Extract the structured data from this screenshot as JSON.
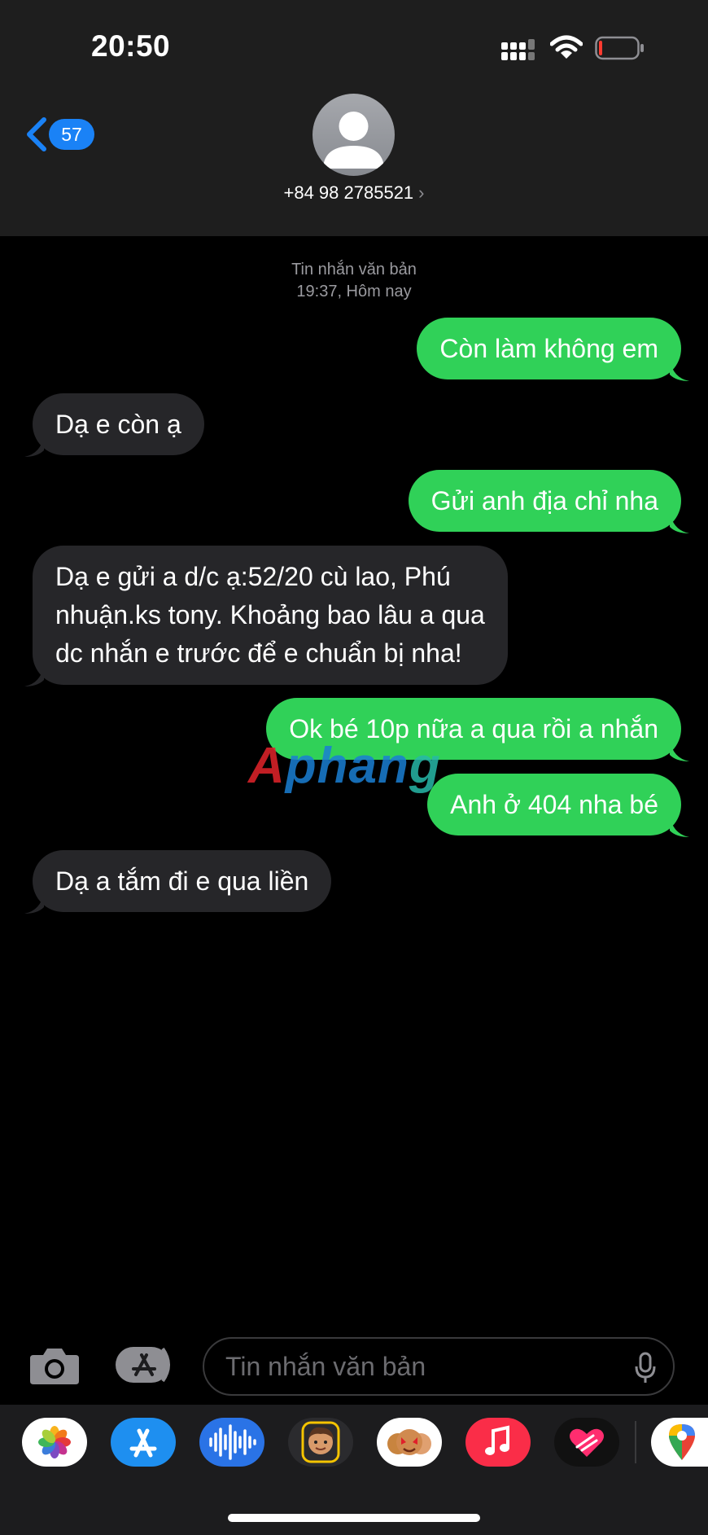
{
  "status_bar": {
    "time": "20:50"
  },
  "nav": {
    "back_count": "57",
    "contact": "+84 98 2785521",
    "contact_chevron": "›"
  },
  "thread": {
    "service": "Tin nhắn văn bản",
    "timestamp": "19:37, Hôm nay"
  },
  "messages": [
    {
      "dir": "sent",
      "text": "Còn làm không em"
    },
    {
      "dir": "received",
      "text": "Dạ e còn ạ"
    },
    {
      "dir": "sent",
      "text": "Gửi anh địa chỉ nha"
    },
    {
      "dir": "received",
      "lines": [
        "Dạ e gửi a d/c ạ:52/20 cù lao, Phú",
        "nhuận.ks tony. Khoảng bao lâu a qua",
        "dc nhắn e trước để e chuẩn bị nha!"
      ]
    },
    {
      "dir": "sent",
      "text": "Ok bé 10p nữa a qua rồi a nhắn"
    },
    {
      "dir": "sent",
      "text": "Anh ở 404 nha bé"
    },
    {
      "dir": "received",
      "text": "Dạ a tắm đi e qua liền"
    }
  ],
  "watermark": {
    "part_a": "A",
    "part_b": "phan",
    "part_c": "g"
  },
  "composer": {
    "placeholder": "Tin nhắn văn bản"
  },
  "app_tray": [
    "photos-app",
    "app-store-app",
    "audio-message-app",
    "memoji-app",
    "animoji-app",
    "music-app",
    "digital-touch-app",
    "maps-app"
  ],
  "colors": {
    "sent_bubble": "#30d158",
    "received_bubble": "#262629",
    "accent": "#1a82f6",
    "header": "#1e1e1e"
  }
}
